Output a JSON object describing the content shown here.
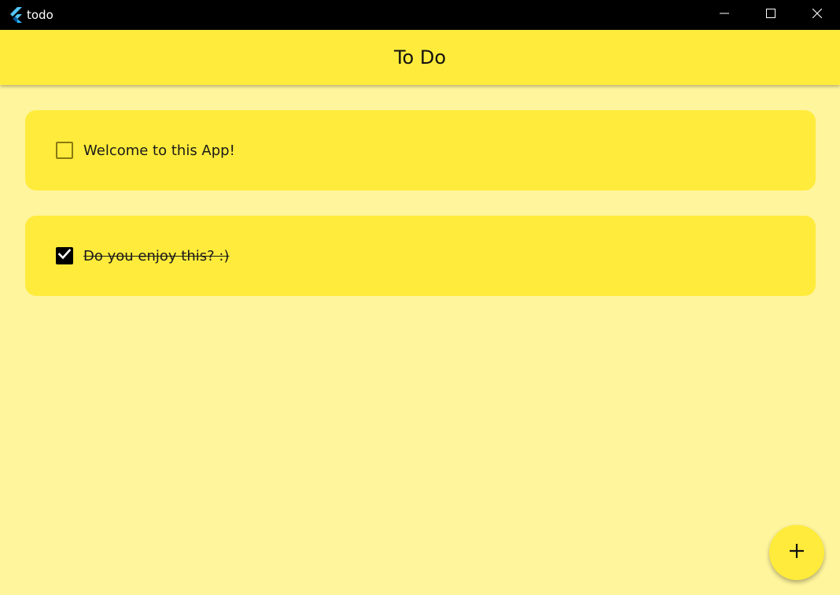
{
  "window": {
    "title": "todo",
    "app_icon": "flutter-logo-icon",
    "controls": [
      "minimize-icon",
      "maximize-icon",
      "close-icon"
    ]
  },
  "appbar": {
    "title": "To Do"
  },
  "todos": [
    {
      "text": "Welcome to this App!",
      "checked": false
    },
    {
      "text": "Do you enjoy this? :)",
      "checked": true
    }
  ],
  "fab": {
    "icon": "plus-icon"
  },
  "colors": {
    "background": "#fff59d",
    "accent": "#ffeb3b",
    "titlebar": "#000000"
  }
}
